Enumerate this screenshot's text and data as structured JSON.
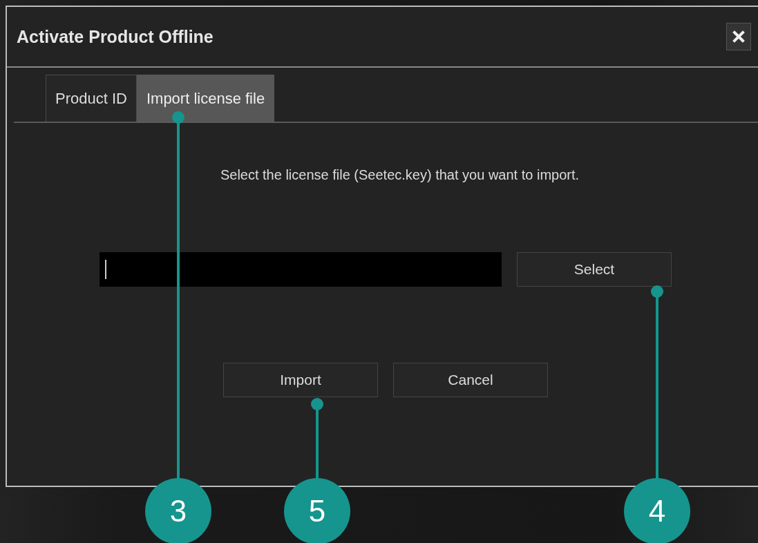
{
  "dialog": {
    "title": "Activate Product Offline"
  },
  "tabs": [
    {
      "label": "Product ID",
      "selected": false
    },
    {
      "label": "Import license file",
      "selected": true
    }
  ],
  "message": "Select the license file (Seetec.key) that you want to import.",
  "file_field": {
    "focused": true
  },
  "select_button": "Select",
  "buttons": [
    "Import",
    "Cancel"
  ],
  "callouts": [
    {
      "number": "3"
    },
    {
      "number": "5"
    },
    {
      "number": "4"
    }
  ]
}
